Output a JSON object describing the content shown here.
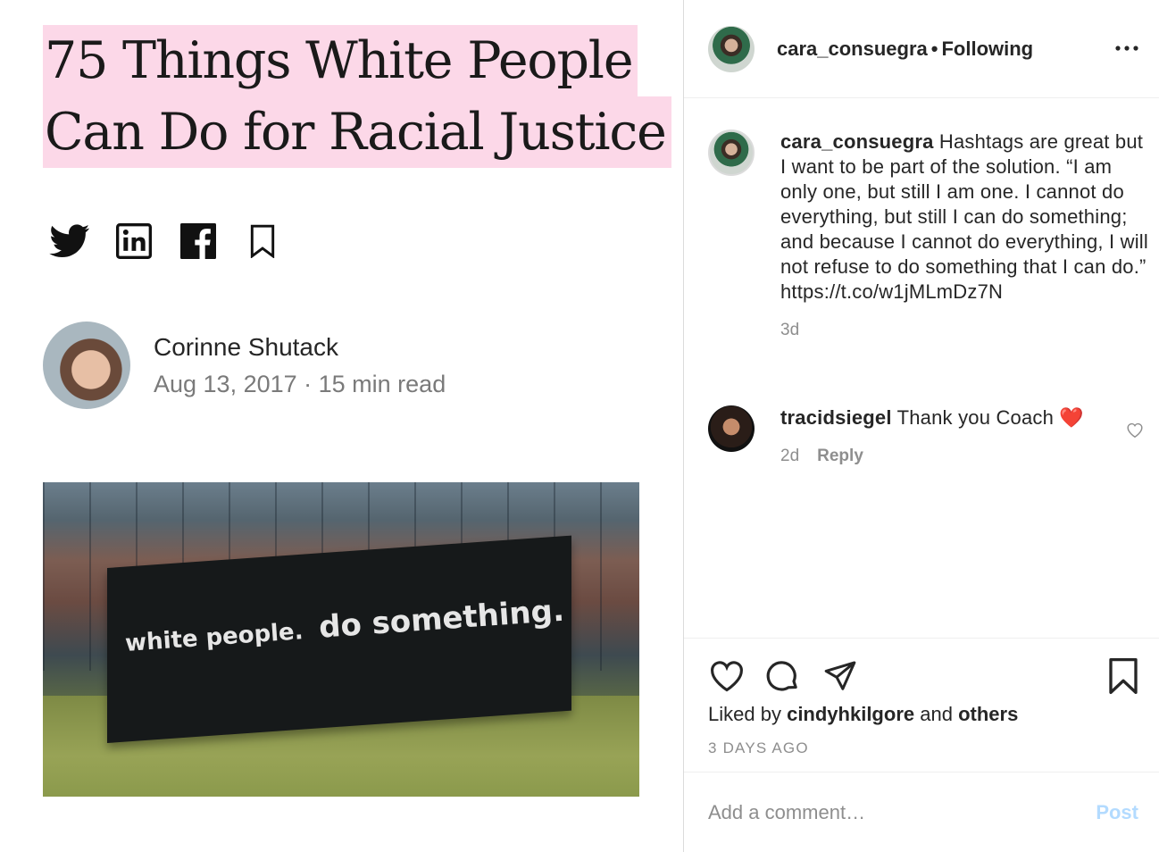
{
  "article": {
    "headline_line1": "75 Things White People",
    "headline_line2": "Can Do for Racial Justice",
    "share_icons": [
      "twitter-icon",
      "linkedin-icon",
      "facebook-icon",
      "bookmark-icon"
    ],
    "author_name": "Corinne Shutack",
    "author_meta": "Aug 13, 2017 · 15 min read",
    "photo_text_1": "white people.",
    "photo_text_2": "do something."
  },
  "post": {
    "username": "cara_consuegra",
    "separator": "•",
    "follow_status": "Following",
    "more_icon": "more-options-icon"
  },
  "comments": [
    {
      "username": "cara_consuegra",
      "text": "Hashtags are great but I want to be part of the solution. “I am only one, but still I am one. I cannot do everything, but still I can do something; and because I cannot do everything, I will not refuse to do something that I can do.” https://t.co/w1jMLmDz7N",
      "age": "3d"
    },
    {
      "username": "tracidsiegel",
      "text": "Thank you Coach ❤️",
      "age": "2d",
      "reply_label": "Reply"
    }
  ],
  "actions": {
    "icons": [
      "heart-icon",
      "comment-icon",
      "share-icon",
      "save-icon"
    ],
    "liked_by_prefix": "Liked by",
    "liked_by_user": "cindyhkilgore",
    "liked_by_and": "and",
    "liked_by_others": "others",
    "timestamp": "3 DAYS AGO"
  },
  "add_comment": {
    "placeholder": "Add a comment…",
    "post_label": "Post",
    "post_color": "#b3dbff"
  }
}
